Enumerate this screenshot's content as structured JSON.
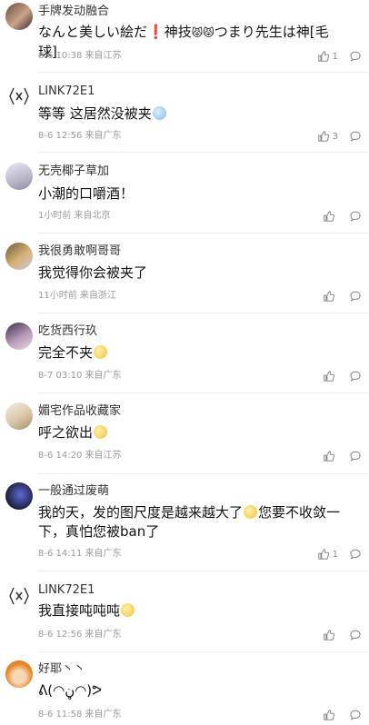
{
  "comments": [
    {
      "username": "手牌发动融合",
      "text_a": "なんと美しい絵だ",
      "text_b": "❗",
      "text_c": "神技",
      "text_d": "😾😾",
      "text_e": "つまり先生は神[毛球]",
      "meta": "8-6 10:38 来自江苏",
      "likes": "1",
      "avatar_icon": "anime-avatar-icon"
    },
    {
      "username": "LINK72E1",
      "text_a": "等等 这居然没被夹",
      "emoji_a": "😱",
      "meta": "8-6 12:56 来自广东",
      "likes": "3",
      "avatar_icon": "link-logo-icon"
    },
    {
      "username": "无壳椰子草加",
      "text_a": "小潮的口嚼酒！",
      "meta": "1小时前 来自北京",
      "likes": "",
      "avatar_icon": "anime-avatar-icon"
    },
    {
      "username": "我很勇敢啊哥哥",
      "text_a": "我觉得你会被夹了",
      "meta": "11小时前 来自浙江",
      "likes": "",
      "avatar_icon": "cat-avatar-icon"
    },
    {
      "username": "吃货西行玖",
      "text_a": "完全不夹",
      "emoji_a": "😼",
      "meta": "8-7 03:10 来自广东",
      "likes": "",
      "avatar_icon": "anime-avatar-icon"
    },
    {
      "username": "媚宅作品收藏家",
      "text_a": "呼之欲出",
      "emoji_a": "😻",
      "meta": "8-6 14:20 来自江苏",
      "likes": "",
      "avatar_icon": "anime-avatar-icon"
    },
    {
      "username": "一般通过废萌",
      "text_a": "我的天，发的图尺度是越来越大了",
      "emoji_a": "😂",
      "text_b": "您要不收敛一下，真怕您被ban了",
      "meta": "8-6 14:11 来自广东",
      "likes": "1",
      "avatar_icon": "anime-avatar-icon"
    },
    {
      "username": "LINK72E1",
      "text_a": "我直接吨吨吨",
      "emoji_a": "😼",
      "meta": "8-6 12:56 来自广东",
      "likes": "",
      "avatar_icon": "link-logo-icon"
    },
    {
      "username": "好耶丶丶",
      "text_a": "ᕕ(◠ڼ◠)ᕗ",
      "meta": "8-6 11:58 来自广东",
      "likes": "",
      "avatar_icon": "orange-hair-avatar-icon"
    }
  ],
  "icons": {
    "like": "thumbs-up-icon",
    "reply": "comment-bubble-icon"
  },
  "colors": {
    "text": "#111111",
    "meta": "#9a9a9a",
    "divider": "#eeeeee",
    "accent_red": "#e02020"
  }
}
